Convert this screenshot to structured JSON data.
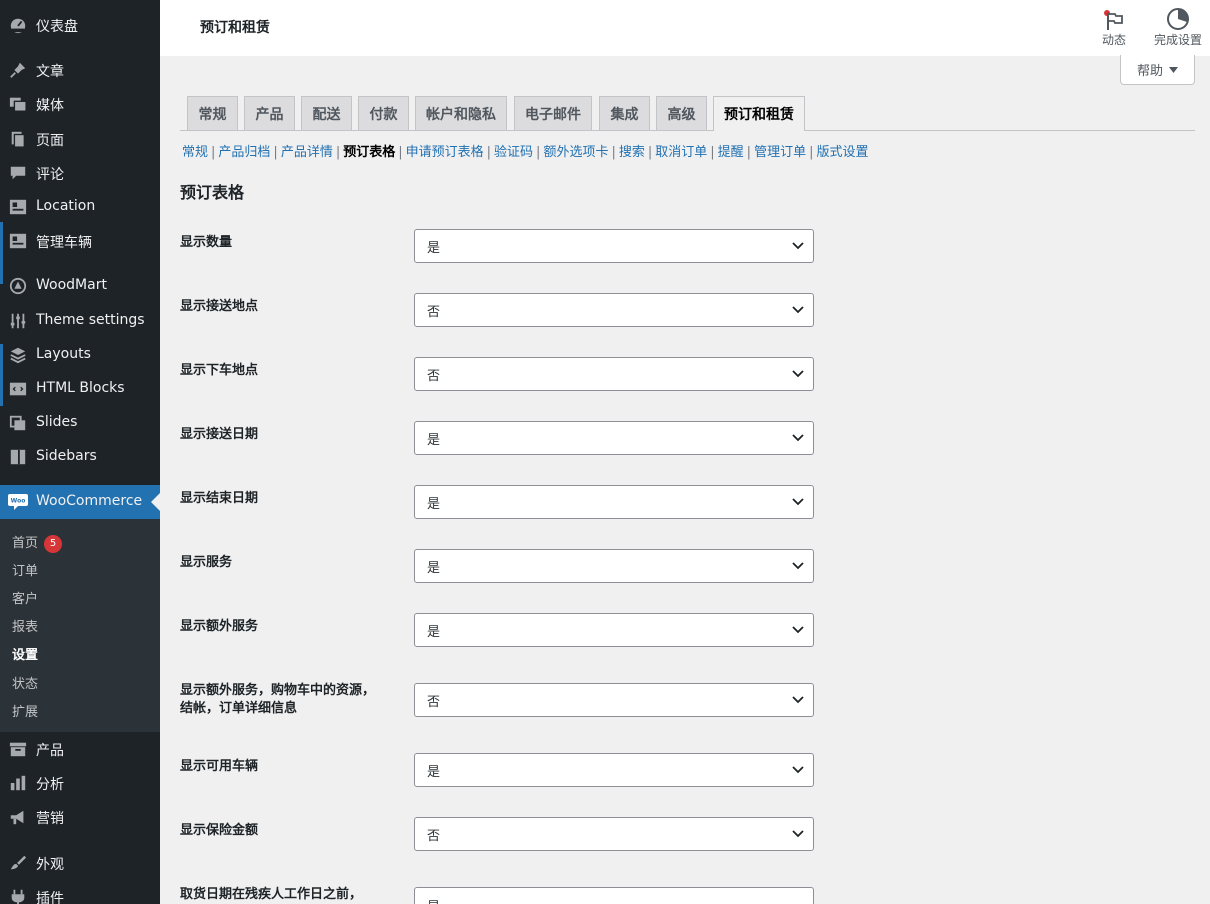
{
  "sidebar": {
    "menu": [
      {
        "label": "仪表盘",
        "icon": "dashboard-icon"
      },
      {
        "label": "文章",
        "icon": "pin-icon"
      },
      {
        "label": "媒体",
        "icon": "media-icon"
      },
      {
        "label": "页面",
        "icon": "page-icon"
      },
      {
        "label": "评论",
        "icon": "comment-icon"
      },
      {
        "label": "Location",
        "icon": "location-icon"
      },
      {
        "label": "管理车辆",
        "icon": "vehicle-icon"
      },
      {
        "label": "WoodMart",
        "icon": "woodmart-icon"
      },
      {
        "label": "Theme settings",
        "icon": "sliders-icon"
      },
      {
        "label": "Layouts",
        "icon": "layers-icon"
      },
      {
        "label": "HTML Blocks",
        "icon": "html-block-icon"
      },
      {
        "label": "Slides",
        "icon": "slides-icon"
      },
      {
        "label": "Sidebars",
        "icon": "sidebars-icon"
      },
      {
        "label": "WooCommerce",
        "icon": "woo-icon"
      },
      {
        "label": "产品",
        "icon": "archive-icon"
      },
      {
        "label": "分析",
        "icon": "chart-bar-icon"
      },
      {
        "label": "营销",
        "icon": "megaphone-icon"
      },
      {
        "label": "外观",
        "icon": "brush-icon"
      },
      {
        "label": "插件",
        "icon": "plugin-icon"
      }
    ],
    "woo_submenu": [
      {
        "label": "首页",
        "badge": "5"
      },
      {
        "label": "订单"
      },
      {
        "label": "客户"
      },
      {
        "label": "报表"
      },
      {
        "label": "设置"
      },
      {
        "label": "状态"
      },
      {
        "label": "扩展"
      }
    ],
    "woo_logo_text": "Woo"
  },
  "topbar": {
    "title": "预订和租赁",
    "activity_label": "动态",
    "setup_label": "完成设置",
    "help_label": "帮助"
  },
  "tabs": [
    "常规",
    "产品",
    "配送",
    "付款",
    "帐户和隐私",
    "电子邮件",
    "集成",
    "高级",
    "预订和租赁"
  ],
  "subnav": [
    "常规",
    "产品归档",
    "产品详情",
    "预订表格",
    "申请预订表格",
    "验证码",
    "额外选项卡",
    "搜索",
    "取消订单",
    "提醒",
    "管理订单",
    "版式设置"
  ],
  "section_title": "预订表格",
  "fields": [
    {
      "label": "显示数量",
      "value": "是"
    },
    {
      "label": "显示接送地点",
      "value": "否"
    },
    {
      "label": "显示下车地点",
      "value": "否"
    },
    {
      "label": "显示接送日期",
      "value": "是"
    },
    {
      "label": "显示结束日期",
      "value": "是"
    },
    {
      "label": "显示服务",
      "value": "是"
    },
    {
      "label": "显示额外服务",
      "value": "是"
    },
    {
      "label": "显示额外服务，购物车中的资源，结帐，订单详细信息",
      "value": "否"
    },
    {
      "label": "显示可用车辆",
      "value": "是"
    },
    {
      "label": "显示保险金额",
      "value": "否"
    },
    {
      "label": "取货日期在残疾人工作日之前，",
      "value": "是"
    }
  ],
  "colors": {
    "accent": "#2271b1",
    "sidebar_bg": "#1d2327",
    "submenu_bg": "#2c3338",
    "badge": "#d63638",
    "notification_dot": "#d63638"
  }
}
